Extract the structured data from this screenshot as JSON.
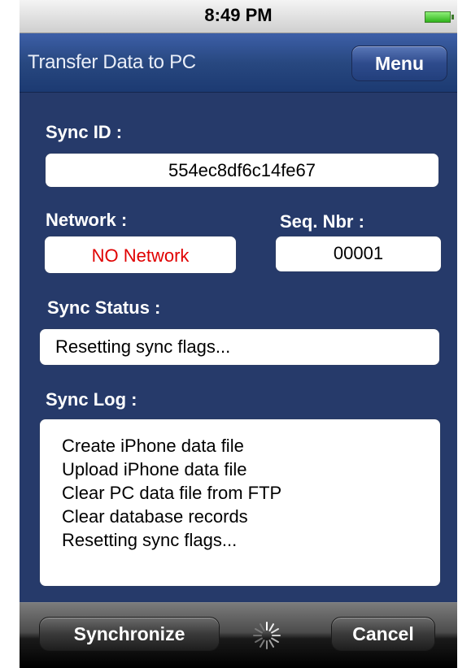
{
  "status_bar": {
    "time": "8:49 PM",
    "battery_icon": "battery-full-icon"
  },
  "nav": {
    "title": "Transfer Data to PC",
    "menu_label": "Menu"
  },
  "sync_id": {
    "label": "Sync ID :",
    "value": "554ec8df6c14fe67"
  },
  "network": {
    "label": "Network :",
    "value": "NO Network",
    "value_color": "#e00000"
  },
  "seq": {
    "label": "Seq. Nbr :",
    "value": "00001"
  },
  "sync_status": {
    "label": "Sync Status :",
    "value": "Resetting sync flags..."
  },
  "sync_log": {
    "label": "Sync Log :",
    "lines": [
      "Create iPhone data file",
      "Upload iPhone data file",
      "Clear PC data file from FTP",
      "Clear database records",
      "Resetting sync flags..."
    ]
  },
  "toolbar": {
    "synchronize_label": "Synchronize",
    "spinner_icon": "activity-spinner-icon",
    "cancel_label": "Cancel"
  },
  "colors": {
    "background": "#263a6a",
    "navbar": "#2b4a87",
    "toolbar": "#1a1a1a",
    "accent_error": "#e00000"
  }
}
